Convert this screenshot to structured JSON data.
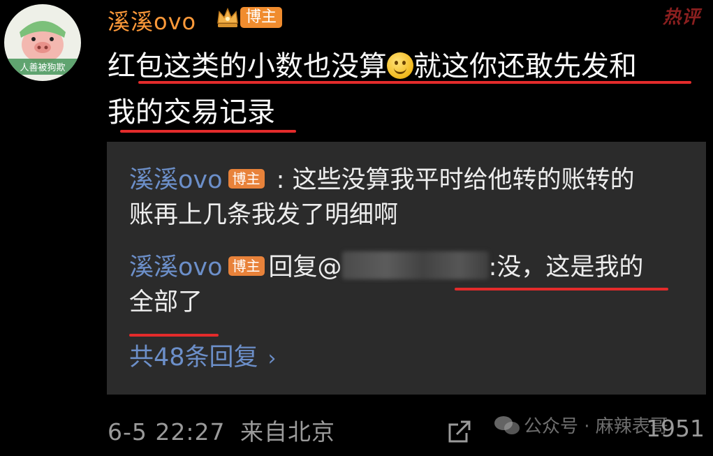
{
  "comment": {
    "author": {
      "name": "溪溪ovo",
      "badge": "博主",
      "avatar_caption": "人善被狗欺"
    },
    "hot_tag": "热评",
    "text": {
      "line1_before_emoji": "红包这类的小数也没算",
      "emoji": "smile-emoji",
      "line1_after_emoji": "就这你还敢先发和",
      "line2": "我的交易记录"
    },
    "meta": {
      "timestamp": "6-5 22:27",
      "location": "来自北京"
    },
    "like_count": "1951"
  },
  "replies": [
    {
      "author": "溪溪ovo",
      "badge": "博主",
      "separator": " : ",
      "text": "这些没算我平时给他转的账转的",
      "text_cont": "账再上几条我发了明细啊"
    },
    {
      "author": "溪溪ovo",
      "badge": "博主",
      "reply_prefix": "回复@",
      "redacted": "redacted-username",
      "text": ":没，这是我的",
      "text_cont": "全部了"
    }
  ],
  "more_replies": "共48条回复",
  "watermark": "公众号 · 麻辣表哥",
  "colors": {
    "background": "#000000",
    "reply_box": "#2b2b2b",
    "username": "#ff9a3a",
    "link_blue": "#6c8fc9",
    "badge": "#f08c2e",
    "annotation_red": "#e32b2b"
  }
}
